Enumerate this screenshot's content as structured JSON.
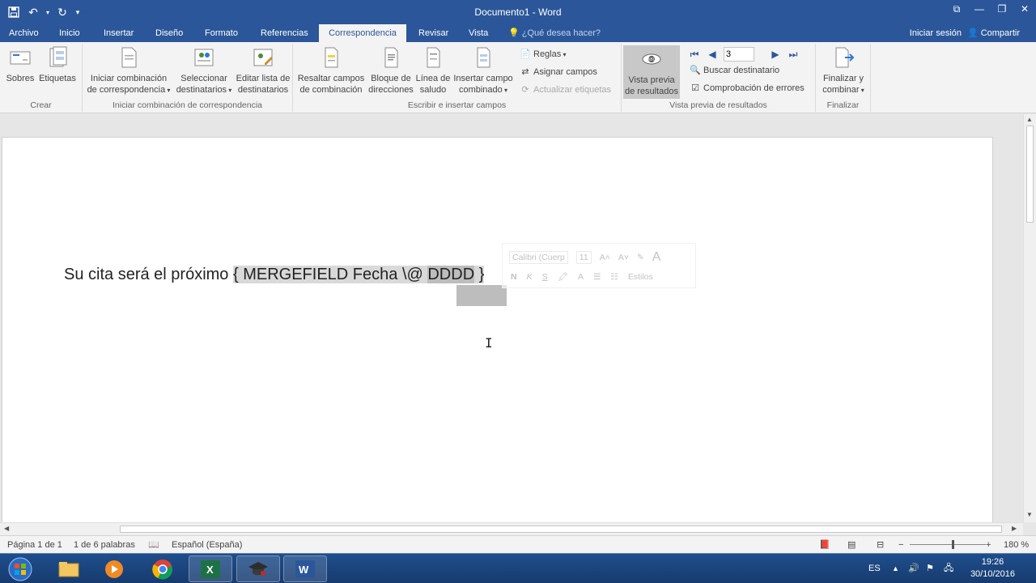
{
  "window": {
    "title": "Documento1 - Word"
  },
  "qat": {
    "save_icon": "save-icon",
    "undo_icon": "undo-icon",
    "redo_icon": "redo-icon"
  },
  "tabs": [
    {
      "label": "Archivo"
    },
    {
      "label": "Inicio"
    },
    {
      "label": "Insertar"
    },
    {
      "label": "Diseño"
    },
    {
      "label": "Formato"
    },
    {
      "label": "Referencias"
    },
    {
      "label": "Correspondencia"
    },
    {
      "label": "Revisar"
    },
    {
      "label": "Vista"
    }
  ],
  "tell_me": "¿Qué desea hacer?",
  "sign_in": "Iniciar sesión",
  "share": "Compartir",
  "ribbon": {
    "crear": {
      "label": "Crear",
      "sobres": "Sobres",
      "etiquetas": "Etiquetas"
    },
    "iniciar": {
      "label": "Iniciar combinación de correspondencia",
      "iniciar_1": "Iniciar combinación",
      "iniciar_2": "de correspondencia",
      "seleccionar_1": "Seleccionar",
      "seleccionar_2": "destinatarios",
      "editar_1": "Editar lista de",
      "editar_2": "destinatarios"
    },
    "escribir": {
      "label": "Escribir e insertar campos",
      "resaltar_1": "Resaltar campos",
      "resaltar_2": "de combinación",
      "bloque_1": "Bloque de",
      "bloque_2": "direcciones",
      "linea_1": "Línea de",
      "linea_2": "saludo",
      "insertar_1": "Insertar campo",
      "insertar_2": "combinado",
      "reglas": "Reglas",
      "asignar": "Asignar campos",
      "actualizar": "Actualizar etiquetas"
    },
    "vista_previa": {
      "label": "Vista previa de resultados",
      "vista_1": "Vista previa",
      "vista_2": "de resultados",
      "record": "3",
      "buscar": "Buscar destinatario",
      "comprobacion": "Comprobación de errores"
    },
    "finalizar": {
      "label": "Finalizar",
      "fin_1": "Finalizar y",
      "fin_2": "combinar"
    }
  },
  "document": {
    "text_before": "Su cita será el próximo ",
    "field_start": "{ MERGEFIELD Fecha \\@ ",
    "field_selected": "DDDD",
    "field_end": " }"
  },
  "mini_toolbar": {
    "font": "Calibri (Cuerp",
    "size": "11",
    "bold": "N",
    "italic": "K",
    "underline": "S",
    "styles": "Estilos"
  },
  "status": {
    "page": "Página 1 de 1",
    "words": "1 de 6 palabras",
    "language": "Español (España)",
    "zoom": "180 %"
  },
  "taskbar": {
    "lang": "ES",
    "time": "19:26",
    "date": "30/10/2016"
  },
  "colors": {
    "word_blue": "#2b579a",
    "excel_green": "#1e7145"
  }
}
